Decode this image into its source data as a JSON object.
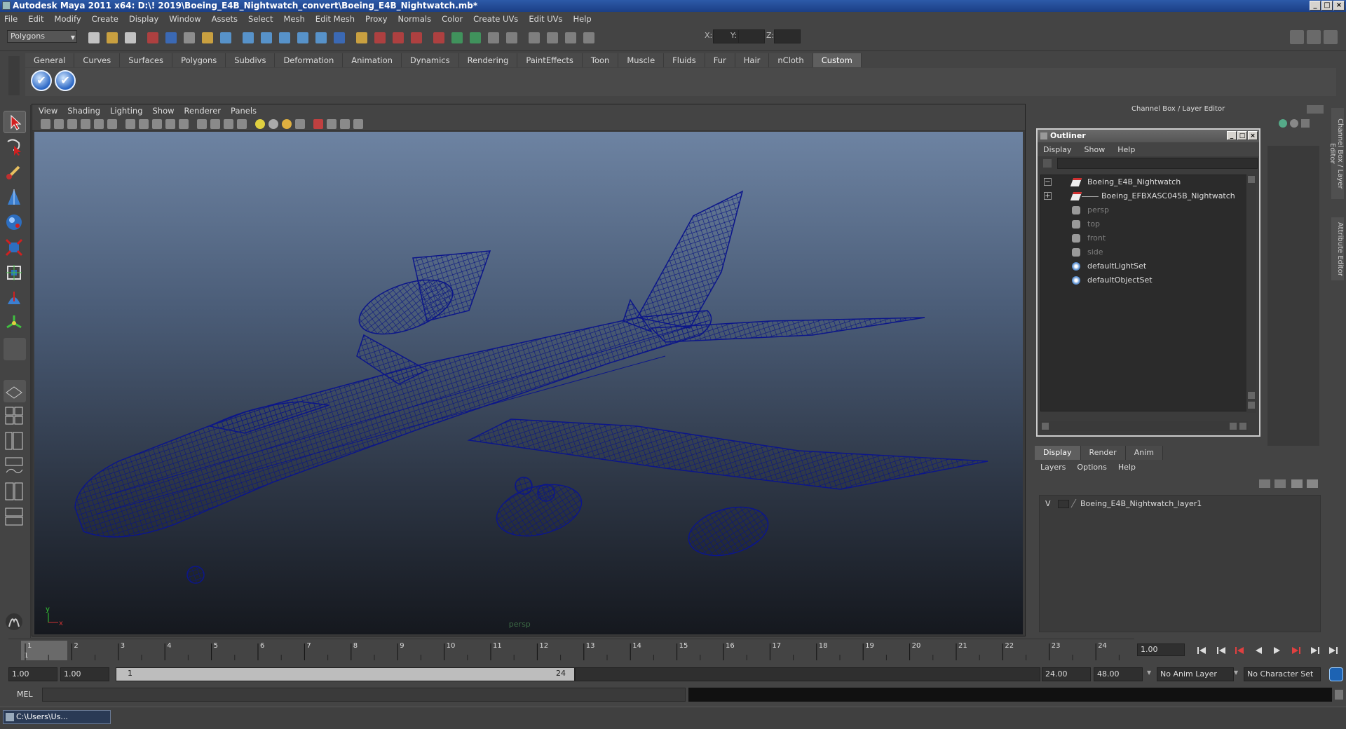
{
  "window": {
    "title": "Autodesk Maya 2011 x64: D:\\! 2019\\Boeing_E4B_Nightwatch_convert\\Boeing_E4B_Nightwatch.mb*"
  },
  "menubar": [
    "File",
    "Edit",
    "Modify",
    "Create",
    "Display",
    "Window",
    "Assets",
    "Select",
    "Mesh",
    "Edit Mesh",
    "Proxy",
    "Normals",
    "Color",
    "Create UVs",
    "Edit UVs",
    "Help"
  ],
  "status": {
    "mode": "Polygons",
    "x_label": "X:",
    "y_label": "Y:",
    "z_label": "Z:"
  },
  "shelf": {
    "tabs": [
      "General",
      "Curves",
      "Surfaces",
      "Polygons",
      "Subdivs",
      "Deformation",
      "Animation",
      "Dynamics",
      "Rendering",
      "PaintEffects",
      "Toon",
      "Muscle",
      "Fluids",
      "Fur",
      "Hair",
      "nCloth",
      "Custom"
    ],
    "active_tab": "Custom"
  },
  "viewport": {
    "menu": [
      "View",
      "Shading",
      "Lighting",
      "Show",
      "Renderer",
      "Panels"
    ],
    "camera_label": "persp",
    "wire_color": "#0d1a7a"
  },
  "channel_box": {
    "title": "Channel Box / Layer Editor"
  },
  "outliner": {
    "title": "Outliner",
    "menu": [
      "Display",
      "Show",
      "Help"
    ],
    "items": [
      {
        "label": "Boeing_E4B_Nightwatch",
        "dim": false,
        "expand": "−"
      },
      {
        "label": "Boeing_EFBXASC045B_Nightwatch",
        "dim": false,
        "expand": "+"
      },
      {
        "label": "persp",
        "dim": true
      },
      {
        "label": "top",
        "dim": true
      },
      {
        "label": "front",
        "dim": true
      },
      {
        "label": "side",
        "dim": true
      },
      {
        "label": "defaultLightSet",
        "dim": false
      },
      {
        "label": "defaultObjectSet",
        "dim": false
      }
    ]
  },
  "layer_editor": {
    "tabs": [
      "Display",
      "Render",
      "Anim"
    ],
    "active_tab": "Display",
    "menu": [
      "Layers",
      "Options",
      "Help"
    ],
    "layer": {
      "visibility": "V",
      "name": "Boeing_E4B_Nightwatch_layer1"
    }
  },
  "side_tabs": [
    "Channel Box / Layer Editor",
    "Attribute Editor"
  ],
  "timeline": {
    "ticks": [
      "1",
      "2",
      "3",
      "4",
      "5",
      "6",
      "7",
      "8",
      "9",
      "10",
      "11",
      "12",
      "13",
      "14",
      "15",
      "16",
      "17",
      "18",
      "19",
      "20",
      "21",
      "22",
      "23",
      "24"
    ],
    "current_frame": "1.00",
    "frame_marker": "1"
  },
  "range": {
    "start": "1.00",
    "playback_start": "1.00",
    "slider_start": "1",
    "slider_end": "24",
    "playback_end": "24.00",
    "end": "48.00",
    "anim_layer": "No Anim Layer",
    "character_set": "No Character Set"
  },
  "command": {
    "label": "MEL"
  },
  "taskbar": {
    "item": "C:\\Users\\Us..."
  }
}
